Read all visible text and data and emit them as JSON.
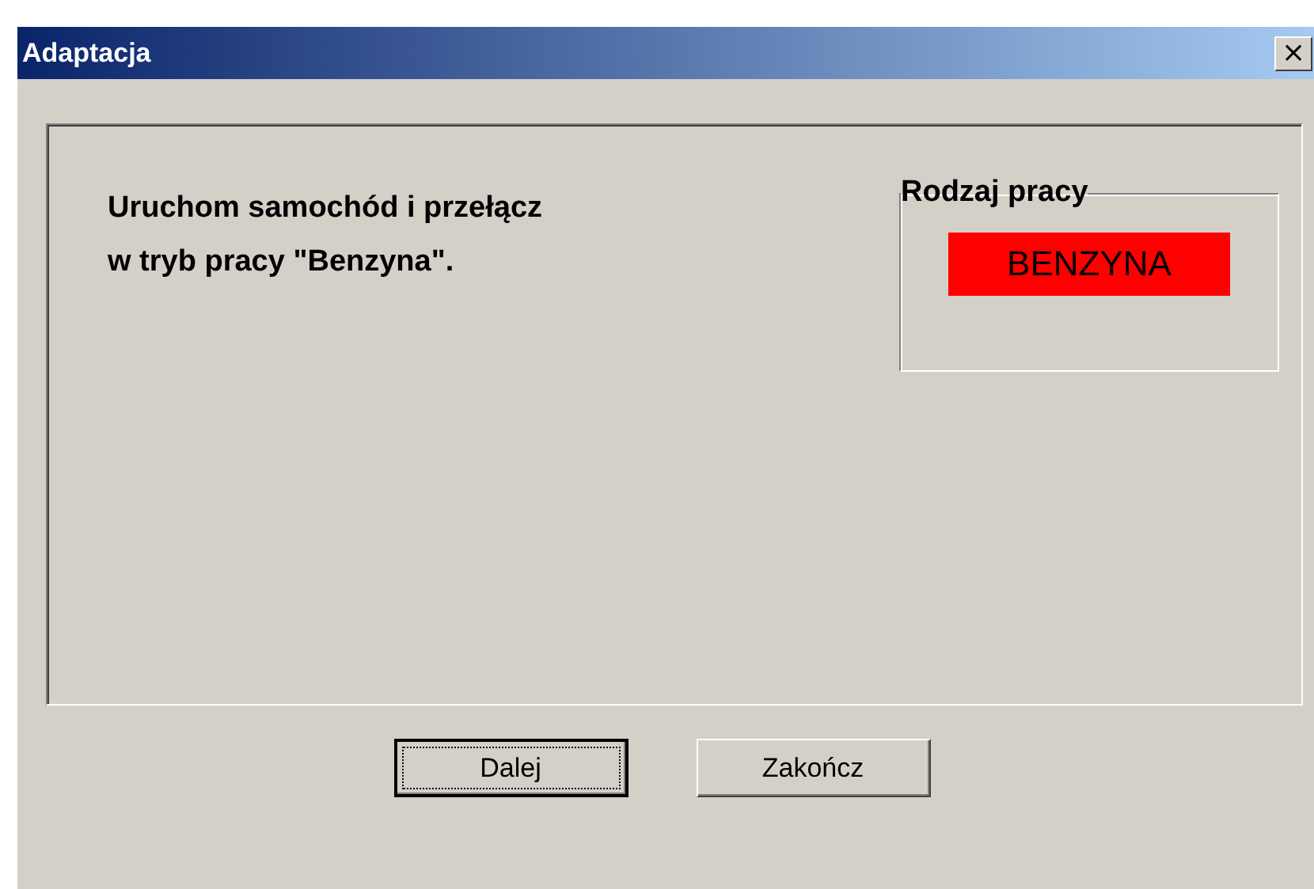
{
  "window": {
    "title": "Adaptacja",
    "close": "×"
  },
  "message": {
    "lines": [
      "Uruchom samochód i przełącz",
      "w tryb pracy \"Benzyna\"."
    ]
  },
  "fuel_group": {
    "legend": "Rodzaj pracy",
    "indicator": {
      "label": "BENZYNA",
      "color": "#ff0000"
    }
  },
  "buttons": [
    {
      "label": "Dalej",
      "focused": true
    },
    {
      "label": "Zakończ",
      "focused": false
    }
  ]
}
